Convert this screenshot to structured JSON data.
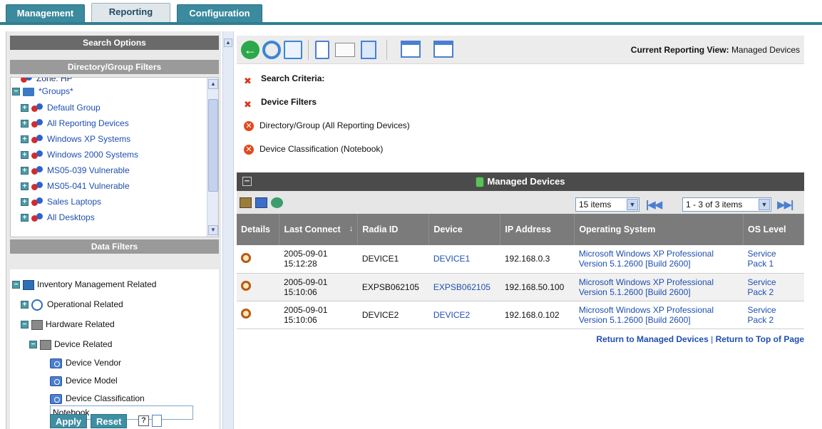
{
  "tabs": [
    {
      "label": "Management"
    },
    {
      "label": "Reporting"
    },
    {
      "label": "Configuration"
    }
  ],
  "left": {
    "search_options": "Search Options",
    "directory_filters": "Directory/Group Filters",
    "tree": {
      "partial_top": "Zone: HP",
      "groups_label": "*Groups*",
      "items": [
        {
          "label": "Default Group"
        },
        {
          "label": "All Reporting Devices"
        },
        {
          "label": "Windows XP Systems"
        },
        {
          "label": "Windows 2000 Systems"
        },
        {
          "label": "MS05-039 Vulnerable"
        },
        {
          "label": "MS05-041 Vulnerable"
        },
        {
          "label": "Sales Laptops"
        },
        {
          "label": "All Desktops"
        }
      ]
    },
    "data_filters": "Data Filters",
    "data_tree": {
      "inventory": "Inventory Management Related",
      "operational": "Operational Related",
      "hardware": "Hardware Related",
      "device_related": "Device Related",
      "device_vendor": "Device Vendor",
      "device_model": "Device Model",
      "device_classification": "Device Classification"
    },
    "filter_value": "Notebook",
    "apply_label": "Apply",
    "reset_label": "Reset",
    "help_glyph": "?"
  },
  "toolbar": {
    "view_prefix": "Current Reporting View:",
    "view_name": "Managed Devices"
  },
  "criteria": {
    "search_criteria": "Search Criteria:",
    "device_filters": "Device Filters",
    "directory_group": "Directory/Group (All Reporting Devices)",
    "device_classification": "Device Classification (Notebook)"
  },
  "grid": {
    "title": "Managed Devices",
    "page_size": "15 items",
    "page_range": "1 - 3 of 3 items",
    "columns": [
      "Details",
      "Last Connect",
      "Radia ID",
      "Device",
      "IP Address",
      "Operating System",
      "OS Level"
    ],
    "rows": [
      {
        "date": "2005-09-01",
        "time": "15:12:28",
        "radia_id": "DEVICE1",
        "device": "DEVICE1",
        "ip": "192.168.0.3",
        "os1": "Microsoft Windows XP Professional",
        "os2": "Version 5.1.2600 [Build 2600]",
        "lvl1": "Service",
        "lvl2": "Pack 1"
      },
      {
        "date": "2005-09-01",
        "time": "15:10:06",
        "radia_id": "EXPSB062105",
        "device": "EXPSB062105",
        "ip": "192.168.50.100",
        "os1": "Microsoft Windows XP Professional",
        "os2": "Version 5.1.2600 [Build 2600]",
        "lvl1": "Service",
        "lvl2": "Pack 2"
      },
      {
        "date": "2005-09-01",
        "time": "15:10:06",
        "radia_id": "DEVICE2",
        "device": "DEVICE2",
        "ip": "192.168.0.102",
        "os1": "Microsoft Windows XP Professional",
        "os2": "Version 5.1.2600 [Build 2600]",
        "lvl1": "Service",
        "lvl2": "Pack 2"
      }
    ]
  },
  "links": {
    "return_managed": "Return to Managed Devices",
    "separator": "|",
    "return_top": "Return to Top of Page"
  },
  "colors": {
    "tab": "#3b8a9e",
    "header_dark": "#4b4b4b",
    "link": "#1f4fb0"
  }
}
